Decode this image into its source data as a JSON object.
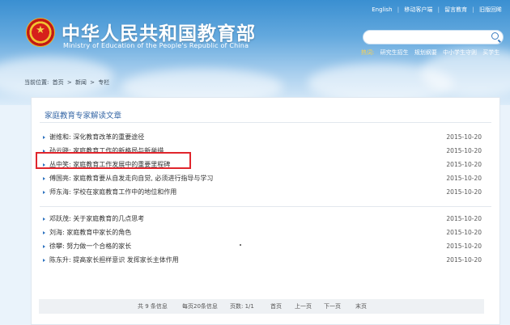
{
  "header": {
    "ministry_cn": "中华人民共和国教育部",
    "ministry_en": "Ministry of Education of the People's Republic of China",
    "toplinks": [
      "English",
      "移动客户端",
      "留言教育",
      "旧版回眸"
    ],
    "search": {
      "placeholder": ""
    },
    "hot_label": "热词:",
    "hot_words": [
      "研究生招生",
      "规划纲要",
      "中小学生守则",
      "买学生"
    ]
  },
  "breadcrumb": {
    "label": "当前位置:",
    "items": [
      "首页",
      "新闻",
      "专栏"
    ]
  },
  "panel": {
    "title": "家庭教育专家解读文章",
    "group1": [
      {
        "title": "谢维和: 深化教育改革的重要途径",
        "date": "2015-10-20"
      },
      {
        "title": "孙云晓: 家庭教育工作的新格局与新举措",
        "date": "2015-10-20"
      },
      {
        "title": "丛中笑: 家庭教育工作发展中的重要里程碑",
        "date": "2015-10-20"
      },
      {
        "title": "傅国亮: 家庭教育要从自发走向自觉, 必须进行指导与学习",
        "date": "2015-10-20"
      },
      {
        "title": "师东海: 学校在家庭教育工作中的地位和作用",
        "date": "2015-10-20"
      }
    ],
    "group2": [
      {
        "title": "邓跃茂: 关于家庭教育的几点思考",
        "date": "2015-10-20"
      },
      {
        "title": "刘海: 家庭教育中家长的角色",
        "date": "2015-10-20"
      },
      {
        "title": "徐攀: 努力做一个合格的家长",
        "date": "2015-10-20"
      },
      {
        "title": "陈东升: 提高家长担样意识 发挥家长主体作用",
        "date": "2015-10-20"
      }
    ]
  },
  "pager": {
    "total": "共 9 条信息",
    "per_page": "每页20条信息",
    "pages": "页数: 1/1",
    "first": "首页",
    "prev": "上一页",
    "next": "下一页",
    "last": "末页"
  }
}
